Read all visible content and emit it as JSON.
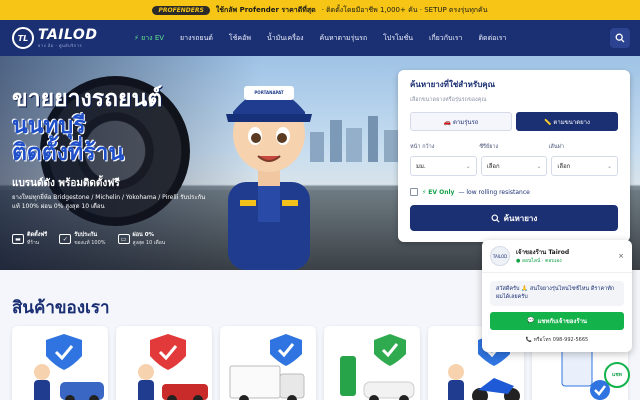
{
  "promo": {
    "brand": "PROFENDERS",
    "text_bold": "ใช้กลัพ Profender ราคาดีที่สุด",
    "text": "· ติดตั้งโดยมีอาชีพ 1,000+ คัน · SETUP ตรงรุ่นทุกคัน"
  },
  "nav": {
    "logo_mark": "TL",
    "logo_text": "TAILOD",
    "logo_sub": "ยาง ล้อ · ศูนย์บริการ",
    "menu": [
      {
        "label": "⚡ ยาง EV",
        "ev": true
      },
      {
        "label": "ยางรถยนต์"
      },
      {
        "label": "โช้คอัพ"
      },
      {
        "label": "น้ำมันเครื่อง"
      },
      {
        "label": "ค้นหาตามรุ่นรถ"
      },
      {
        "label": "โปรโมชั่น"
      },
      {
        "label": "เกี่ยวกับเรา"
      },
      {
        "label": "ติดต่อเรา"
      }
    ]
  },
  "hero": {
    "line1": "ขายยางรถยนต์",
    "line2": "นนทบุรี",
    "line3": "ติดตั้งที่ร้าน",
    "subtitle": "แบรนด์ดัง พร้อมติดตั้งฟรี",
    "desc": "ยางใหม่ทุกยี่ห้อ Bridgestone / Michelin / Yokohama / Pirelli รับประกันแท้ 100% ผ่อน 0% สูงสุด 10 เดือน",
    "mascot_cap": "PORTANAPAT",
    "features": [
      {
        "title": "ติดตั้งฟรี",
        "sub": "ที่ร้าน",
        "icon": "truck-icon"
      },
      {
        "title": "รับประกัน",
        "sub": "ของแท้ 100%",
        "icon": "shield-check-icon"
      },
      {
        "title": "ผ่อน 0%",
        "sub": "สูงสุด 10 เดือน",
        "icon": "card-icon"
      }
    ]
  },
  "search_card": {
    "title": "ค้นหายางที่ใช่สำหรับคุณ",
    "subtitle": "เลือกขนาดยางหรือรุ่นรถของคุณ",
    "tab_car": "🚗 ตามรุ่นรถ",
    "tab_size": "📏 ตามขนาดยาง",
    "label_width": "หน้า กว้าง",
    "label_ratio": "ซีรีย์ยาง",
    "label_rim": "เส้นผ่า",
    "sel_width": "มม.",
    "sel_ratio": "เลือก",
    "sel_rim": "เลือก",
    "ev_label": "⚡ EV Only",
    "ev_suffix": "— low rolling resistance",
    "button": "ค้นหายาง"
  },
  "products": {
    "title": "สินค้าของเรา",
    "items": [
      {
        "name": "product-card-suv"
      },
      {
        "name": "product-card-pickup"
      },
      {
        "name": "product-card-truck"
      },
      {
        "name": "product-card-ev"
      },
      {
        "name": "product-card-motorcycle"
      },
      {
        "name": "product-card-service"
      }
    ]
  },
  "chat": {
    "avatar_text": "TAILOD",
    "name": "เจ้าของร้าน Tairod",
    "status": "● ออนไลน์ · ตอบเอง",
    "message": "สวัสดีครับ 🙏 สนใจยางรุ่นไหนไซซ์ไหน ดีราคาทักผมได้เลยครับ",
    "button": "แชทกับเจ้าของร้าน",
    "call": "📞 หรือโทร 098-992-5665",
    "float_label": "แชท"
  },
  "colors": {
    "navy": "#1b2f73",
    "promo_yellow": "#f6c515",
    "green": "#13b24a"
  }
}
